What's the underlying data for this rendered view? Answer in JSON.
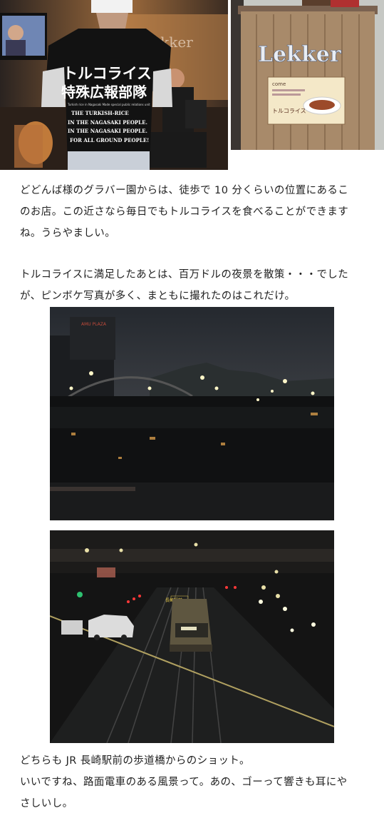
{
  "photos": {
    "shirt": {
      "shirt_title": "トルコライス",
      "shirt_subtitle": "特殊広報部隊",
      "shirt_small": "Turkish rice in Nagasaki Made special public relations unit",
      "shirt_lines": [
        "THE TURKISH-RICE",
        "IN THE NAGASAKI PEOPLE.",
        "IN THE NAGASAKI PEOPLE.",
        "FOR ALL GROUND PEOPLE!"
      ],
      "wall_sign": "Lekker"
    },
    "signboard": {
      "logo": "Lekker",
      "poster_top": "come",
      "poster_label": "トルコライス"
    },
    "night_view": {
      "building_sign": "AMU PLAZA"
    },
    "tram_view": {
      "road_sign": "長崎駅前"
    }
  },
  "text": {
    "p1": [
      "どどんば様のグラバー園からは、徒歩で 10 分くらいの位置にあるこ",
      "のお店。この近さなら毎日でもトルコライスを食べることができます",
      "ね。うらやましい。"
    ],
    "p2": [
      "トルコライスに満足したあとは、百万ドルの夜景を散策・・・でした",
      "が、ピンボケ写真が多く、まともに撮れたのはこれだけ。"
    ],
    "p3": [
      "どちらも JR 長崎駅前の歩道橋からのショット。",
      "いいですね、路面電車のある風景って。あの、ゴーって響きも耳にや",
      "さしいし。"
    ]
  }
}
